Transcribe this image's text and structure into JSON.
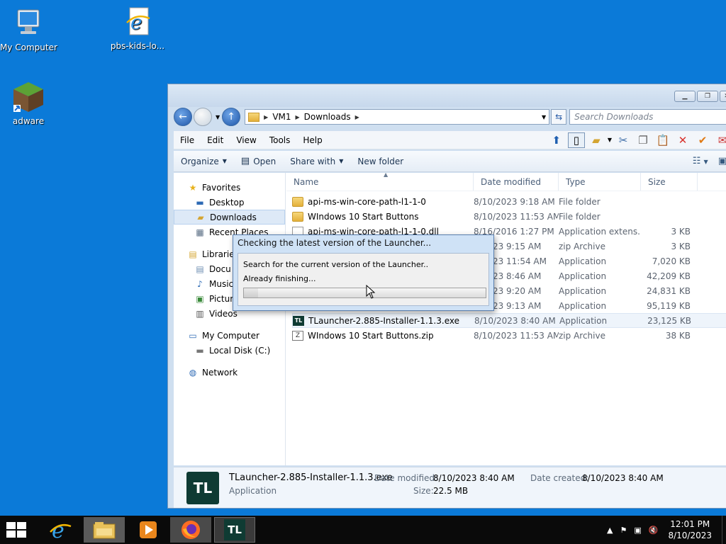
{
  "desktop": {
    "icons": [
      {
        "label": "My Computer"
      },
      {
        "label": "pbs-kids-lo..."
      },
      {
        "label": "adware"
      }
    ]
  },
  "explorer": {
    "address": {
      "segments": [
        "VM1",
        "Downloads"
      ]
    },
    "search_placeholder": "Search Downloads",
    "menu": [
      "File",
      "Edit",
      "View",
      "Tools",
      "Help"
    ],
    "commands": {
      "organize": "Organize",
      "open": "Open",
      "share_with": "Share with",
      "new_folder": "New folder"
    },
    "nav": {
      "favorites": "Favorites",
      "desktop": "Desktop",
      "downloads": "Downloads",
      "recent_places": "Recent Places",
      "libraries": "Libraries",
      "documents": "Docu",
      "music": "Music",
      "pictures": "Pictur",
      "videos": "Videos",
      "my_computer": "My Computer",
      "local_disk": "Local Disk (C:)",
      "network": "Network"
    },
    "columns": {
      "name": "Name",
      "date": "Date modified",
      "type": "Type",
      "size": "Size"
    },
    "files": [
      {
        "name": "api-ms-win-core-path-l1-1-0",
        "date": "8/10/2023 9:18 AM",
        "type": "File folder",
        "size": "",
        "icon": "folder-icon"
      },
      {
        "name": "WIndows 10 Start Buttons",
        "date": "8/10/2023 11:53 AM",
        "type": "File folder",
        "size": "",
        "icon": "folder-icon"
      },
      {
        "name": "api-ms-win-core-path-l1-1-0.dll",
        "date": "8/16/2016 1:27 PM",
        "type": "Application extens...",
        "size": "3 KB",
        "icon": "dll-icon"
      },
      {
        "name": "",
        "date": "0/2023 9:15 AM",
        "type": "zip Archive",
        "size": "3 KB",
        "icon": "zip-icon"
      },
      {
        "name": "",
        "date": "0/2023 11:54 AM",
        "type": "Application",
        "size": "7,020 KB",
        "icon": "app-icon"
      },
      {
        "name": "",
        "date": "0/2023 8:46 AM",
        "type": "Application",
        "size": "42,209 KB",
        "icon": "app-icon"
      },
      {
        "name": "",
        "date": "0/2023 9:20 AM",
        "type": "Application",
        "size": "24,831 KB",
        "icon": "app-icon"
      },
      {
        "name": "",
        "date": "0/2023 9:13 AM",
        "type": "Application",
        "size": "95,119 KB",
        "icon": "app-icon"
      },
      {
        "name": "TLauncher-2.885-Installer-1.1.3.exe",
        "date": "8/10/2023 8:40 AM",
        "type": "Application",
        "size": "23,125 KB",
        "icon": "tlauncher-icon"
      },
      {
        "name": "WIndows 10 Start Buttons.zip",
        "date": "8/10/2023 11:53 AM",
        "type": "zip Archive",
        "size": "38 KB",
        "icon": "zip-icon"
      }
    ],
    "details": {
      "icon_text": "TL",
      "filename": "TLauncher-2.885-Installer-1.1.3.exe",
      "filetype": "Application",
      "modified_label": "Date modified:",
      "modified_value": "8/10/2023 8:40 AM",
      "size_label": "Size:",
      "size_value": "22.5 MB",
      "created_label": "Date created:",
      "created_value": "8/10/2023 8:40 AM"
    }
  },
  "dialog": {
    "title": "Checking the latest version of the Launcher...",
    "line1": "Search for the current version of the Launcher..",
    "line2": "Already finishing...",
    "progress": 0.06
  },
  "taskbar": {
    "apps": [
      "internet-explorer",
      "file-explorer",
      "media-player",
      "firefox",
      "tlauncher"
    ],
    "tlauncher_label": "TL",
    "clock_time": "12:01 PM",
    "clock_date": "8/10/2023"
  }
}
